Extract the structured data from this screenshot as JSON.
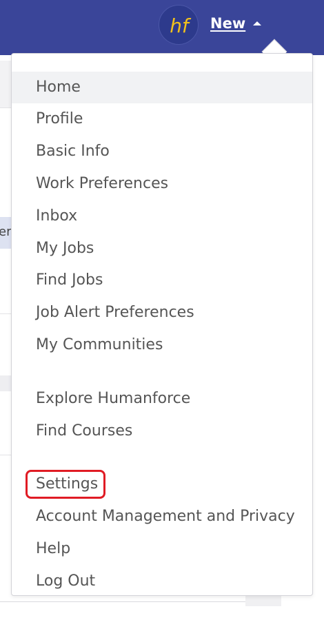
{
  "header": {
    "user_name": "New",
    "brand_color": "#3a4599",
    "avatar_icon": "hf-logo-icon"
  },
  "background": {
    "edge_text": "er"
  },
  "menu": {
    "items": [
      {
        "label": "Home",
        "active": true
      },
      {
        "label": "Profile"
      },
      {
        "label": "Basic Info"
      },
      {
        "label": "Work Preferences"
      },
      {
        "label": "Inbox"
      },
      {
        "label": "My Jobs"
      },
      {
        "label": "Find Jobs"
      },
      {
        "label": "Job Alert Preferences"
      },
      {
        "label": "My Communities"
      },
      {
        "label": "Explore Humanforce"
      },
      {
        "label": "Find Courses"
      },
      {
        "label": "Settings",
        "highlighted": true
      },
      {
        "label": "Account Management and Privacy"
      },
      {
        "label": "Help"
      },
      {
        "label": "Log Out"
      }
    ],
    "highlight_color": "#e01b24"
  }
}
